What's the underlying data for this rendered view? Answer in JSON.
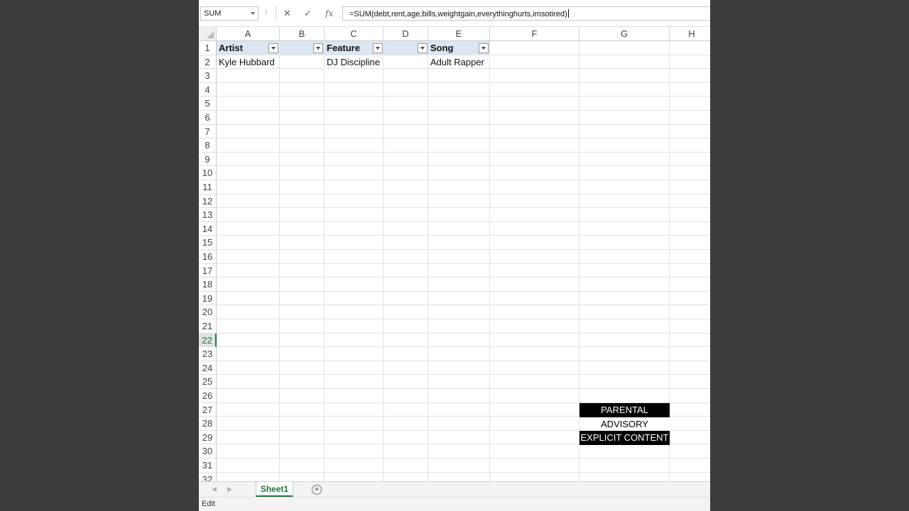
{
  "formula_bar": {
    "name_box": "SUM",
    "dots": "⁝",
    "cancel_glyph": "✕",
    "enter_glyph": "✓",
    "fx_glyph": "fx",
    "formula": "=SUM(debt,rent,age,bills,weightgain,everythinghurts,imsotired)"
  },
  "columns": [
    "A",
    "B",
    "C",
    "D",
    "E",
    "F",
    "G",
    "H"
  ],
  "rows": [
    "1",
    "2",
    "3",
    "4",
    "5",
    "6",
    "7",
    "8",
    "9",
    "10",
    "11",
    "12",
    "13",
    "14",
    "15",
    "16",
    "17",
    "18",
    "19",
    "20",
    "21",
    "22",
    "23",
    "24",
    "25",
    "26",
    "27",
    "28",
    "29",
    "30",
    "31",
    "32"
  ],
  "active_row": "22",
  "table": {
    "headers": {
      "artist": "Artist",
      "feature": "Feature",
      "song": "Song"
    },
    "row2": {
      "artist": "Kyle Hubbard",
      "feature": "DJ Discipline",
      "song": "Adult Rapper"
    }
  },
  "parental_advisory": {
    "line1": "PARENTAL",
    "line2": "ADVISORY",
    "line3": "EXPLICIT CONTENT"
  },
  "tabs": {
    "active": "Sheet1",
    "add_glyph": "+"
  },
  "nav_glyphs": {
    "prev": "◀",
    "next": "▶"
  },
  "status": {
    "mode": "Edit"
  },
  "colors": {
    "accent": "#217346",
    "header_fill": "#dce6f1",
    "background": "#3c3c3c"
  }
}
